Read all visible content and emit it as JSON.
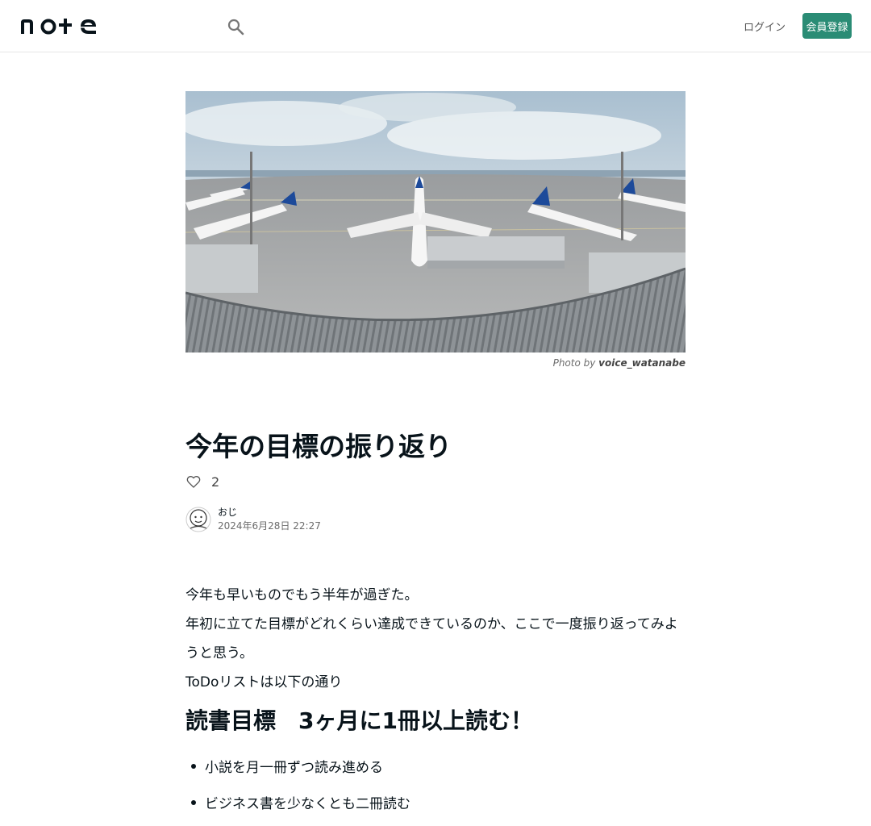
{
  "header": {
    "logo_text": "note",
    "login_label": "ログイン",
    "signup_label": "会員登録"
  },
  "hero": {
    "credit_prefix": "Photo by",
    "credit_author": "voice_watanabe"
  },
  "article": {
    "title": "今年の目標の振り返り",
    "like_count": "2",
    "author_name": "おじ",
    "date": "2024年6月28日 22:27",
    "body_lines": [
      "今年も早いものでもう半年が過ぎた。",
      "年初に立てた目標がどれくらい達成できているのか、ここで一度振り返ってみようと思う。",
      "ToDoリストは以下の通り"
    ],
    "section_heading": "読書目標　3ヶ月に1冊以上読む！",
    "list_items": [
      "小説を月一冊ずつ読み進める",
      "ビジネス書を少なくとも二冊読む"
    ]
  },
  "colors": {
    "accent": "#2a8c75",
    "text": "#08131a"
  },
  "icons": {
    "search": "search-icon",
    "like": "heart-icon"
  }
}
